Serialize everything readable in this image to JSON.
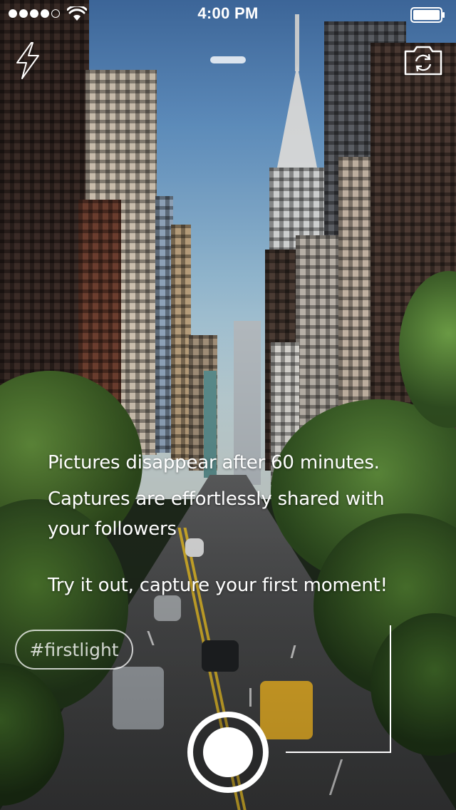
{
  "status_bar": {
    "time": "4:00 PM",
    "signal_bars_filled": 4,
    "signal_bars_total": 5,
    "icons": [
      "signal-dots",
      "wifi-icon",
      "battery-icon"
    ]
  },
  "controls": {
    "flash_icon": "lightning-bolt-icon",
    "handle_icon": "drag-handle",
    "switch_camera_icon": "camera-switch-icon",
    "shutter_icon": "shutter-button"
  },
  "onboarding": {
    "line1": "Pictures disappear after 60 minutes.",
    "line2a": "Captures are effortlessly shared with",
    "line2b": "your followers",
    "line3": "Try it out, capture your first moment!"
  },
  "hashtag": {
    "label": "#firstlight"
  },
  "colors": {
    "overlay_text": "#ffffff",
    "road_stripe": "#d8b32c"
  }
}
